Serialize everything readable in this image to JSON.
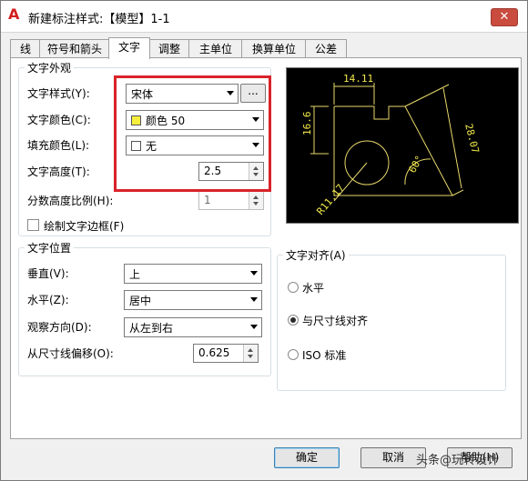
{
  "window": {
    "title": "新建标注样式:【模型】1-1",
    "app_icon": "A",
    "close_label": "✕"
  },
  "tabs": [
    "线",
    "符号和箭头",
    "文字",
    "调整",
    "主单位",
    "换算单位",
    "公差"
  ],
  "active_tab": "文字",
  "text_appearance": {
    "title": "文字外观",
    "style_label": "文字样式(Y):",
    "style_value": "宋体",
    "style_browse": "...",
    "color_label": "文字颜色(C):",
    "color_value": "颜色 50",
    "color_swatch": "#f5ef3c",
    "fill_label": "填充颜色(L):",
    "fill_value": "无",
    "height_label": "文字高度(T):",
    "height_value": "2.5",
    "fraction_label": "分数高度比例(H):",
    "fraction_value": "1",
    "frame_label": "绘制文字边框(F)"
  },
  "text_placement": {
    "title": "文字位置",
    "vertical_label": "垂直(V):",
    "vertical_value": "上",
    "horizontal_label": "水平(Z):",
    "horizontal_value": "居中",
    "view_label": "观察方向(D):",
    "view_value": "从左到右",
    "offset_label": "从尺寸线偏移(O):",
    "offset_value": "0.625"
  },
  "text_alignment": {
    "title": "文字对齐(A)",
    "options": [
      "水平",
      "与尺寸线对齐",
      "ISO 标准"
    ],
    "selected": "与尺寸线对齐"
  },
  "preview": {
    "dim_top": "14.11",
    "dim_left": "16.6",
    "dim_right": "28.07",
    "dim_angle": "60°",
    "dim_radius": "R11.17",
    "line_color": "#e8d86a",
    "text_color": "#f2e84a"
  },
  "footer": {
    "ok": "确定",
    "cancel": "取消",
    "help": "帮助(H)"
  },
  "watermark": "头条@玩转设计"
}
